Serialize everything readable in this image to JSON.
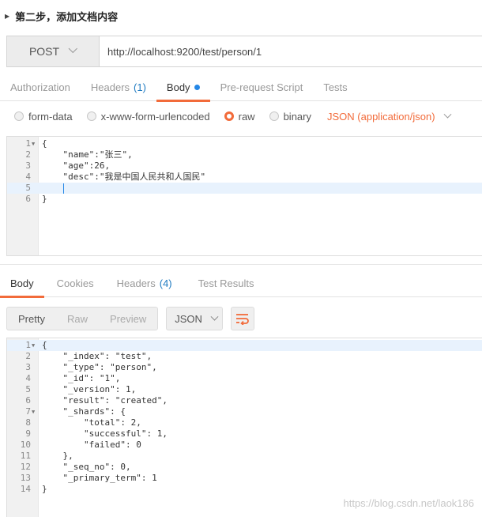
{
  "step": {
    "title": "第二步，添加文档内容"
  },
  "request": {
    "method": "POST",
    "url": "http://localhost:9200/test/person/1"
  },
  "request_tabs": [
    {
      "label": "Authorization"
    },
    {
      "label": "Headers",
      "count": "(1)"
    },
    {
      "label": "Body"
    },
    {
      "label": "Pre-request Script"
    },
    {
      "label": "Tests"
    }
  ],
  "body_types": {
    "options": [
      "form-data",
      "x-www-form-urlencoded",
      "raw",
      "binary"
    ],
    "selected": "raw",
    "content_type": "JSON (application/json)"
  },
  "request_body": {
    "line_numbers": [
      "1",
      "2",
      "3",
      "4",
      "5",
      "6"
    ],
    "lines": [
      "{",
      "    \"name\":\"张三\",",
      "    \"age\":26,",
      "    \"desc\":\"我是中国人民共和人国民\"",
      "",
      "}"
    ]
  },
  "response_tabs": [
    {
      "label": "Body"
    },
    {
      "label": "Cookies"
    },
    {
      "label": "Headers",
      "count": "(4)"
    },
    {
      "label": "Test Results"
    }
  ],
  "response_view": {
    "modes": [
      "Pretty",
      "Raw",
      "Preview"
    ],
    "active_mode": "Pretty",
    "format": "JSON"
  },
  "response_body": {
    "line_numbers": [
      "1",
      "2",
      "3",
      "4",
      "5",
      "6",
      "7",
      "8",
      "9",
      "10",
      "11",
      "12",
      "13",
      "14"
    ],
    "lines": [
      "{",
      "    \"_index\": \"test\",",
      "    \"_type\": \"person\",",
      "    \"_id\": \"1\",",
      "    \"_version\": 1,",
      "    \"result\": \"created\",",
      "    \"_shards\": {",
      "        \"total\": 2,",
      "        \"successful\": 1,",
      "        \"failed\": 0",
      "    },",
      "    \"_seq_no\": 0,",
      "    \"_primary_term\": 1",
      "}"
    ]
  },
  "watermark": "https://blog.csdn.net/laok186",
  "colors": {
    "accent": "#f26b3a",
    "link": "#1f7bc1",
    "dot": "#2587e6"
  }
}
